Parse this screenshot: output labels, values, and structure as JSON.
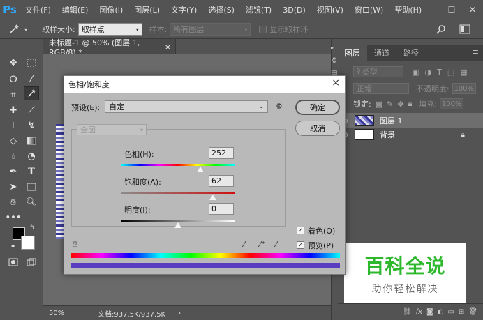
{
  "menubar": {
    "logo": "Ps",
    "items": [
      "文件(F)",
      "编辑(E)",
      "图像(I)",
      "图层(L)",
      "文字(Y)",
      "选择(S)",
      "滤镜(T)",
      "3D(D)",
      "视图(V)",
      "窗口(W)",
      "帮助(H)"
    ]
  },
  "optionsbar": {
    "sample_size_label": "取样大小:",
    "sample_size_value": "取样点",
    "sample_label": "样本:",
    "sample_value": "所有图层",
    "show_ring_label": "显示取样环"
  },
  "document": {
    "tab_title": "未标题-1 @ 50% (图层 1, RGB/8) *",
    "tab_close": "×",
    "zoom": "50%",
    "doc_info": "文档:937.5K/937.5K",
    "status_arrow": "›"
  },
  "panels": {
    "tabs": [
      "图层",
      "通道",
      "路径"
    ],
    "filter_kind": "类型",
    "blend_mode": "正常",
    "opacity_label": "不透明度:",
    "opacity_value": "100%",
    "lock_label": "锁定:",
    "fill_label": "填充:",
    "fill_value": "100%",
    "layers": [
      {
        "name": "图层 1",
        "selected": true
      },
      {
        "name": "背景",
        "selected": false,
        "locked": true
      }
    ],
    "bottom_icons": [
      "link-icon",
      "fx-icon",
      "mask-icon",
      "adjustment-icon",
      "group-icon",
      "new-layer-icon",
      "trash-icon"
    ]
  },
  "dialog": {
    "title": "色相/饱和度",
    "close": "×",
    "preset_label": "预设(E):",
    "preset_value": "自定",
    "channel_value": "全图",
    "hue_label": "色相(H):",
    "hue_value": "252",
    "saturation_label": "饱和度(A):",
    "saturation_value": "62",
    "lightness_label": "明度(I):",
    "lightness_value": "0",
    "ok_label": "确定",
    "cancel_label": "取消",
    "colorize_label": "着色(O)",
    "colorize_checked": true,
    "preview_label": "预览(P)",
    "preview_checked": true,
    "hue_slider": {
      "value": 252,
      "min": -180,
      "max": 180
    },
    "saturation_slider": {
      "value": 62,
      "min": -100,
      "max": 100
    },
    "lightness_slider": {
      "value": 0,
      "min": -100,
      "max": 100
    }
  },
  "watermark": {
    "title": "百科全说",
    "subtitle": "助你轻松解决"
  },
  "colors": {
    "app_bg": "#535353",
    "dialog_bg": "#b9b9b9",
    "watermark_green": "#2eb82e",
    "ps_blue": "#31a8ff"
  }
}
